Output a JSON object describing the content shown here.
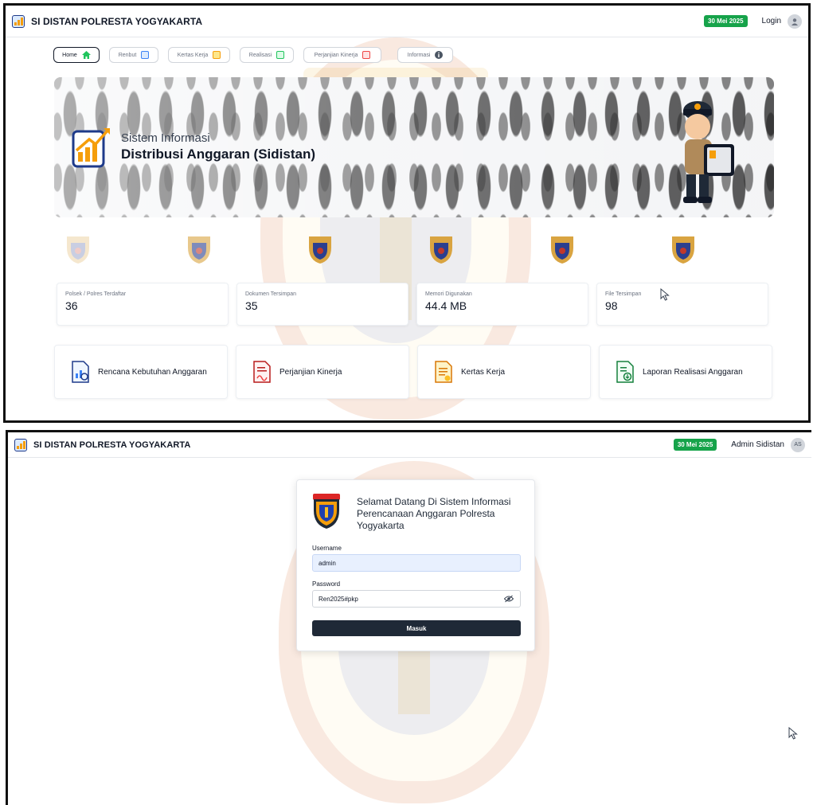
{
  "colors": {
    "accent_green": "#16a34a",
    "primary_dark": "#1f2937",
    "input_autofill": "#e8f0fe"
  },
  "screen_home": {
    "header": {
      "title": "SI DISTAN POLRESTA YOGYAKARTA",
      "date": "30 Mei 2025",
      "user_label": "Login"
    },
    "nav": [
      {
        "label": "Home",
        "icon": "home-icon",
        "active": true
      },
      {
        "label": "Renbut",
        "icon": "document-chart-icon",
        "active": false
      },
      {
        "label": "Kertas Kerja",
        "icon": "document-icon",
        "active": false
      },
      {
        "label": "Realisasi",
        "icon": "document-check-icon",
        "active": false
      },
      {
        "label": "Perjanjian Kinerja",
        "icon": "pdf-icon",
        "active": false
      },
      {
        "label": "Informasi",
        "icon": "info-icon",
        "active": false
      }
    ],
    "hero": {
      "subtitle": "Sistem Informasi",
      "title": "Distribusi Anggaran (Sidistan)",
      "mascot_icon": "police-mascot-icon"
    },
    "emblems": [
      "police-emblem-icon",
      "police-emblem-icon",
      "police-emblem-icon",
      "police-emblem-icon",
      "police-emblem-icon",
      "police-emblem-icon"
    ],
    "stats": [
      {
        "label": "Polsek / Polres Terdaftar",
        "value": "36"
      },
      {
        "label": "Dokumen Tersimpan",
        "value": "35"
      },
      {
        "label": "Memori Digunakan",
        "value": "44.4 MB"
      },
      {
        "label": "File Tersimpan",
        "value": "98"
      }
    ],
    "features": [
      {
        "label": "Rencana Kebutuhan Anggaran",
        "icon": "document-chart-icon"
      },
      {
        "label": "Perjanjian Kinerja",
        "icon": "document-signed-icon"
      },
      {
        "label": "Kertas Kerja",
        "icon": "document-icon"
      },
      {
        "label": "Laporan Realisasi Anggaran",
        "icon": "document-download-icon"
      }
    ]
  },
  "screen_login": {
    "header": {
      "title": "SI DISTAN POLRESTA YOGYAKARTA",
      "date": "30 Mei 2025",
      "user_label": "Admin Sidistan",
      "avatar_initials": "AS"
    },
    "card": {
      "title": "Selamat Datang Di Sistem Informasi Perencanaan Anggaran Polresta Yogyakarta",
      "username_label": "Username",
      "username_value": "admin",
      "password_label": "Password",
      "password_value": "Ren2025#pkp",
      "submit_label": "Masuk"
    }
  }
}
